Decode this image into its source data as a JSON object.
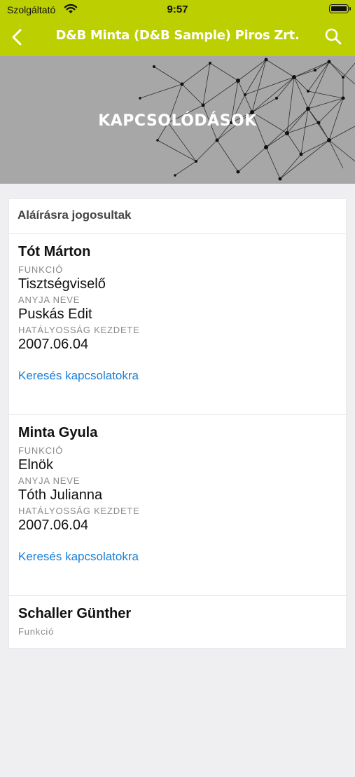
{
  "status": {
    "carrier": "Szolgáltató",
    "time": "9:57"
  },
  "nav": {
    "title": "D&B Minta (D&B Sample) Piros Zrt."
  },
  "hero": {
    "title": "KAPCSOLÓDÁSOK"
  },
  "section": {
    "title": "Aláírásra jogosultak"
  },
  "labels": {
    "function": "FUNKCIÓ",
    "mother_name": "ANYJA NEVE",
    "effective_from": "HATÁLYOSSÁG KEZDETE",
    "search_link": "Keresés kapcsolatokra"
  },
  "people": [
    {
      "name": "Tót Márton",
      "function": "Tisztségviselő",
      "mother_name": "Puskás Edit",
      "effective_from": "2007.06.04"
    },
    {
      "name": "Minta Gyula",
      "function": "Elnök",
      "mother_name": "Tóth Julianna",
      "effective_from": "2007.06.04"
    },
    {
      "name": "Schaller Günther",
      "function": "Funkció"
    }
  ],
  "colors": {
    "accent": "#bccf00",
    "link": "#1a7fd6"
  }
}
